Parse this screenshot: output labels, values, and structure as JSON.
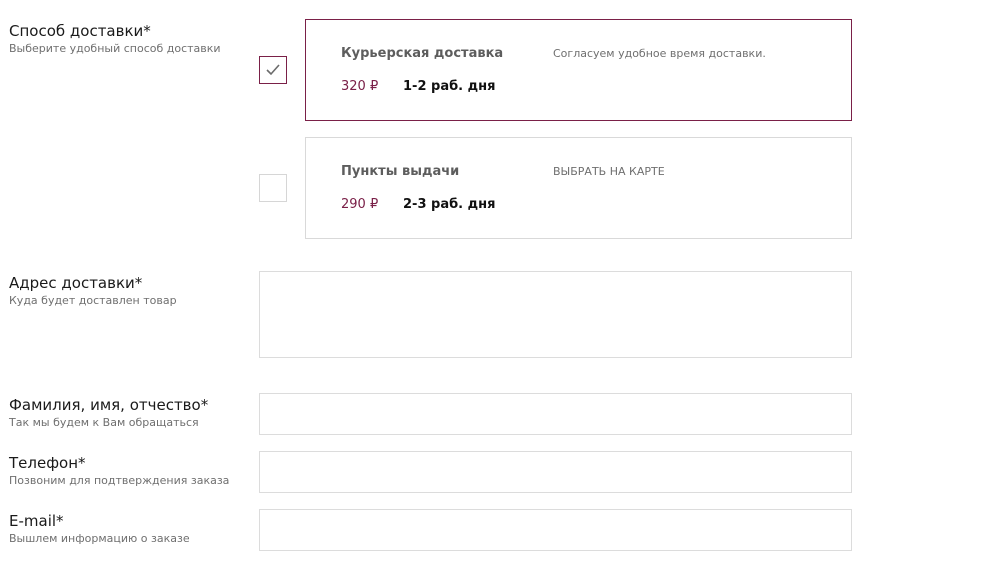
{
  "delivery": {
    "title": "Способ доставки*",
    "hint": "Выберите удобный способ доставки",
    "options": [
      {
        "name": "Курьерская доставка",
        "description": "Согласуем удобное время доставки.",
        "price": "320 ₽",
        "days": "1-2 раб. дня",
        "checked": true,
        "check_icon": "checkmark-icon"
      },
      {
        "name": "Пункты выдачи",
        "link": "ВЫБРАТЬ НА КАРТЕ",
        "price": "290 ₽",
        "days": "2-3 раб. дня",
        "checked": false
      }
    ]
  },
  "address": {
    "title": "Адрес доставки*",
    "hint": "Куда будет доставлен товар",
    "value": ""
  },
  "full_name": {
    "title": "Фамилия, имя, отчество*",
    "hint": "Так мы будем к Вам обращаться",
    "value": ""
  },
  "phone": {
    "title": "Телефон*",
    "hint": "Позвоним для подтверждения заказа",
    "value": ""
  },
  "email": {
    "title": "E-mail*",
    "hint": "Вышлем информацию о заказе",
    "value": ""
  },
  "colors": {
    "accent": "#7a2048",
    "border": "#d9d9d9",
    "text": "#1a1a1a",
    "muted": "#6f6f6f"
  }
}
